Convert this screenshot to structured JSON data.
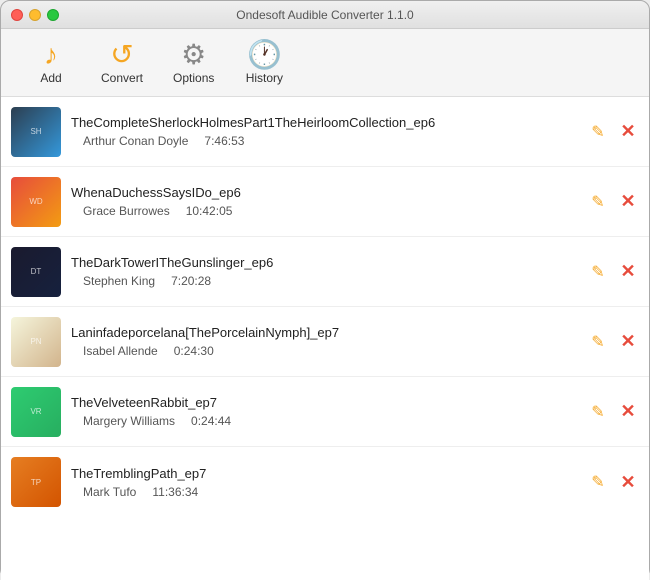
{
  "window": {
    "title": "Ondesoft Audible Converter 1.1.0"
  },
  "toolbar": {
    "add_label": "Add",
    "convert_label": "Convert",
    "options_label": "Options",
    "history_label": "History"
  },
  "books": [
    {
      "id": 1,
      "title": "TheCompleteSherlockHolmesPart1TheHeirloomCollection_ep6",
      "author": "Arthur Conan Doyle",
      "duration": "7:46:53",
      "thumb_class": "thumb-1",
      "thumb_text": "SH"
    },
    {
      "id": 2,
      "title": "WhenaDuchessSaysIDo_ep6",
      "author": "Grace Burrowes",
      "duration": "10:42:05",
      "thumb_class": "thumb-2",
      "thumb_text": "WD"
    },
    {
      "id": 3,
      "title": "TheDarkTowerITheGunslinger_ep6",
      "author": "Stephen King",
      "duration": "7:20:28",
      "thumb_class": "thumb-3",
      "thumb_text": "DT"
    },
    {
      "id": 4,
      "title": "Laninfadeporcelana[ThePorcelainNymph]_ep7",
      "author": "Isabel Allende",
      "duration": "0:24:30",
      "thumb_class": "thumb-4",
      "thumb_text": "PN"
    },
    {
      "id": 5,
      "title": "TheVelveteenRabbit_ep7",
      "author": "Margery Williams",
      "duration": "0:24:44",
      "thumb_class": "thumb-5",
      "thumb_text": "VR"
    },
    {
      "id": 6,
      "title": "TheTremblingPath_ep7",
      "author": "Mark Tufo",
      "duration": "11:36:34",
      "thumb_class": "thumb-6",
      "thumb_text": "TP"
    }
  ]
}
